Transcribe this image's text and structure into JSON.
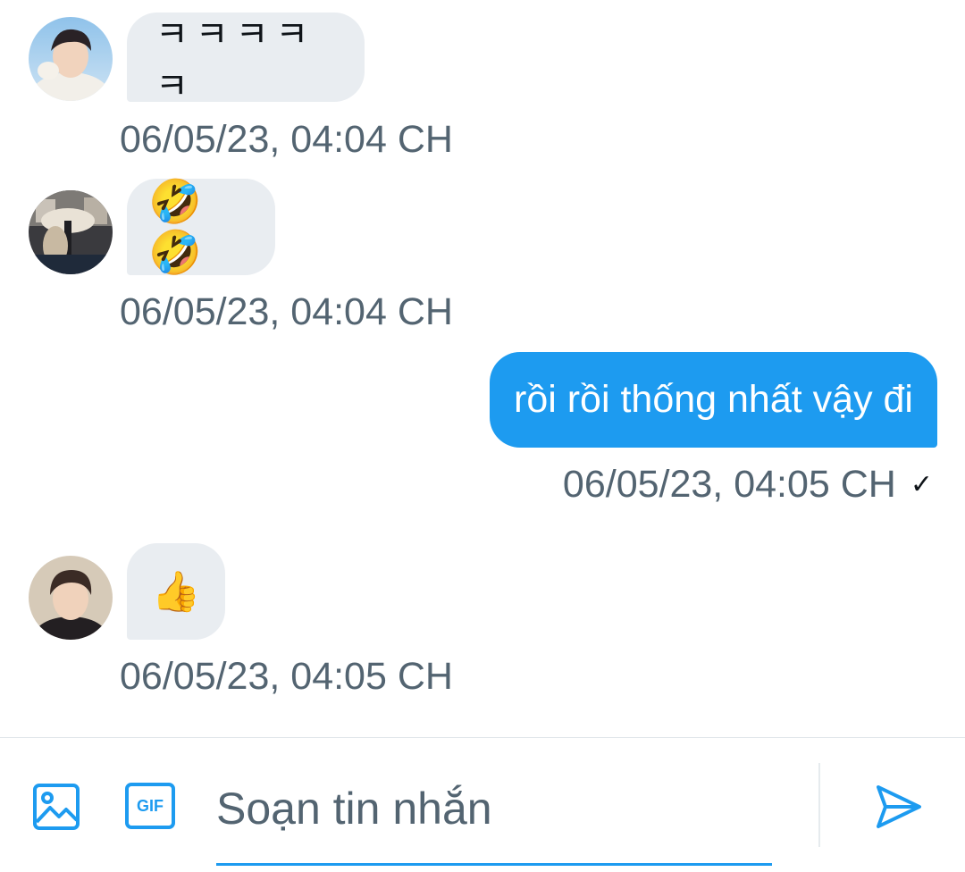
{
  "messages": [
    {
      "direction": "incoming",
      "sender_avatar": "avatar-user-1",
      "text": "ㅋㅋㅋㅋㅋ",
      "timestamp": "06/05/23, 04:04 CH"
    },
    {
      "direction": "incoming",
      "sender_avatar": "avatar-user-2",
      "emoji": "🤣🤣",
      "timestamp": "06/05/23, 04:04 CH"
    },
    {
      "direction": "outgoing",
      "text": "rồi rồi thống nhất vậy đi",
      "timestamp": "06/05/23, 04:05 CH",
      "status_mark": "✓"
    },
    {
      "direction": "incoming",
      "sender_avatar": "avatar-user-3",
      "emoji": "👍",
      "timestamp": "06/05/23, 04:05 CH"
    }
  ],
  "composer": {
    "placeholder": "Soạn tin nhắn",
    "gif_label": "GIF",
    "icons": [
      "image-icon",
      "gif-icon",
      "send-icon"
    ]
  },
  "colors": {
    "accent": "#1d9bf0",
    "incoming_bubble": "#e9edf1",
    "timestamp": "#536471"
  }
}
